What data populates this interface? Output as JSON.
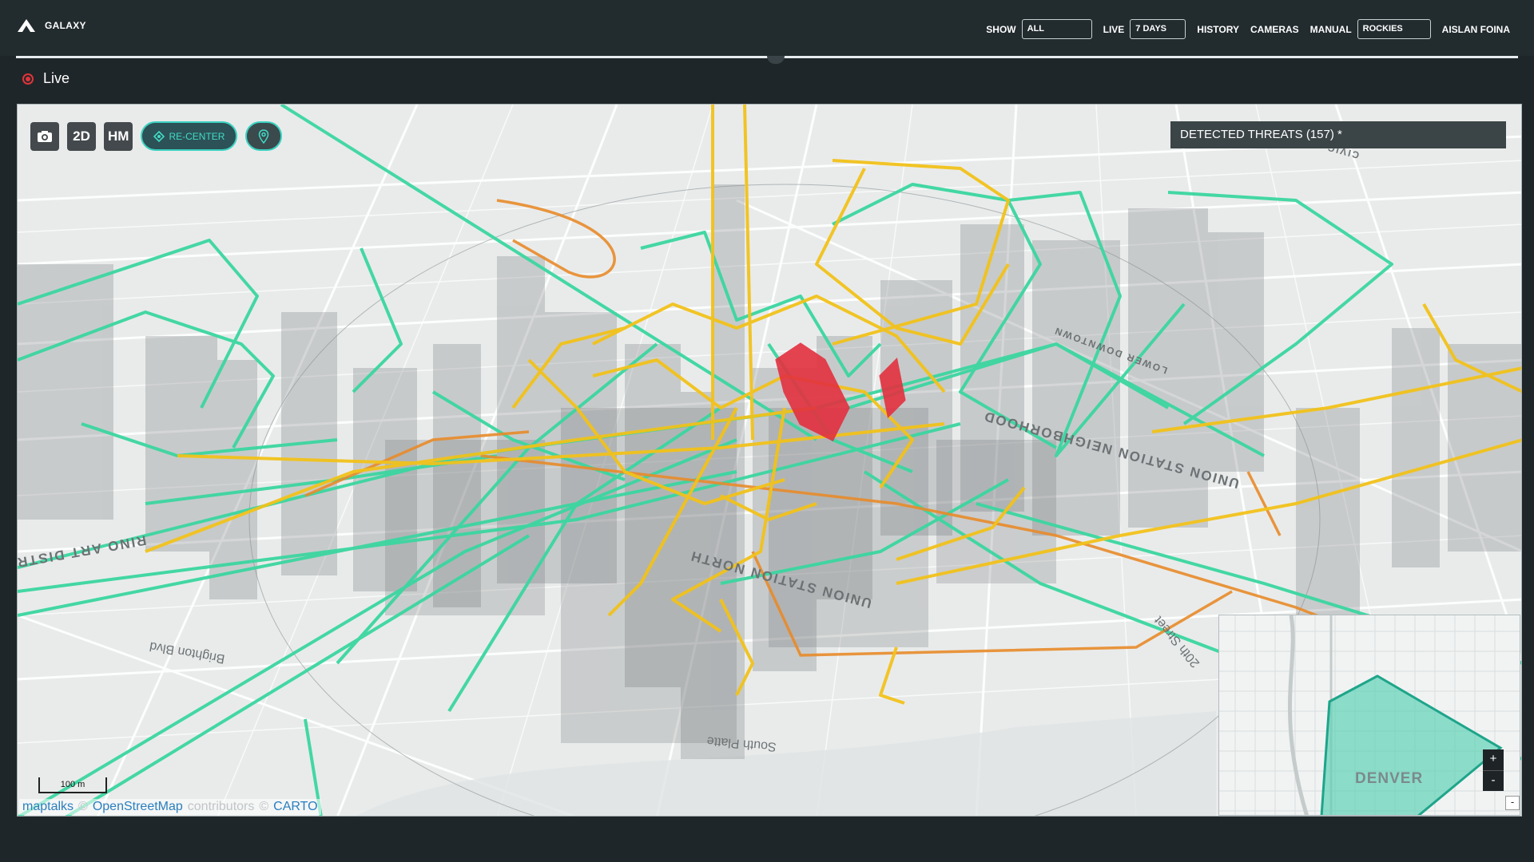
{
  "app": {
    "brand": "GALAXY"
  },
  "nav": {
    "show_label": "SHOW",
    "show_value": "ALL",
    "live_label": "LIVE",
    "live_value": "7 DAYS",
    "history_label": "HISTORY",
    "cameras_label": "CAMERAS",
    "manual_label": "MANUAL",
    "manual_value": "ROCKIES",
    "user_name": "AISLAN FOINA"
  },
  "status": {
    "live_label": "Live"
  },
  "map_toolbar": {
    "camera_icon": "camera-icon",
    "mode_2d": "2D",
    "mode_hm": "HM",
    "recenter_label": "RE-CENTER",
    "location_icon": "location-pin-icon"
  },
  "threats_panel": {
    "title": "DETECTED THREATS",
    "count": "(157) *"
  },
  "map_labels": {
    "union_station_north": "UNION STATION NORTH",
    "union_station_neighborhood": "UNION STATION NEIGHBORHOOD",
    "rino_art_district": "RINO ART DISTRICT",
    "brighton_blvd": "Brighton Blvd",
    "south_platte": "South Platte",
    "lower_downtown": "LOWER DOWNTOWN",
    "civic_center": "CIVIC CENTER",
    "twentieth_street": "20th Street"
  },
  "scale_bar": {
    "label": "100 m"
  },
  "attribution": {
    "maptalks": "maptalks",
    "osm": "OpenStreetMap",
    "contributors": "contributors",
    "carto": "CARTO"
  },
  "minimap": {
    "city_label": "DENVER",
    "zoom_in": "+",
    "zoom_out": "-",
    "collapse": "-"
  },
  "colors": {
    "green": "#3bd6a0",
    "yellow": "#f2c21b",
    "orange": "#e88b2a",
    "red": "#e3303f",
    "teal": "#3bd1c0"
  }
}
